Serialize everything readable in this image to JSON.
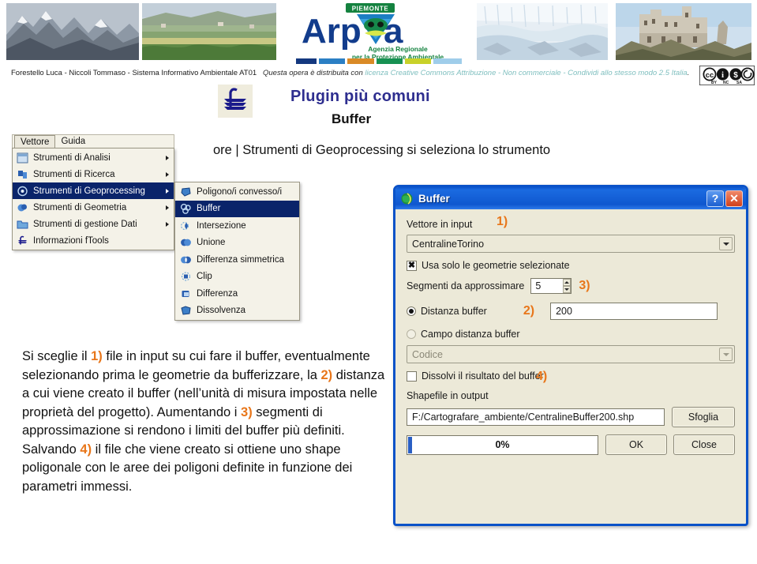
{
  "header": {
    "photos": [
      {
        "name": "snowy-mountains-photo",
        "alt": "Snowy mountain range"
      },
      {
        "name": "farmland-photo",
        "alt": "Cultivated farmland hills"
      },
      {
        "name": "glacier-waterfall-photo",
        "alt": "Glacier and waterfall"
      },
      {
        "name": "abbey-photo",
        "alt": "Sacra di San Michele abbey"
      }
    ],
    "logo": {
      "badge": "PIEMONTE",
      "wordmark": "Arpa",
      "line1": "Agenzia Regionale",
      "line2": "per la Protezione Ambientale"
    },
    "color_bar": [
      "#14387f",
      "#2b7fc4",
      "#d98a26",
      "#179152",
      "#c8d129",
      "#9fcdea"
    ]
  },
  "license": {
    "author": "Forestello Luca - Niccoli Tommaso - Sistema Informativo Ambientale AT01",
    "prefix": "Questa opera è distribuita con ",
    "link": "licenza Creative Commons Attribuzione - Non commerciale - Condividi allo stesso modo 2.5 Italia",
    "suffix": ".",
    "badge": "cc-by-nc-sa-badge"
  },
  "slide": {
    "title": "Plugin più comuni",
    "subtitle": "Buffer",
    "intro": "ore | Strumenti di Geoprocessing si seleziona lo strumento"
  },
  "menubar": {
    "items": [
      {
        "label": "Vettore",
        "active": true
      },
      {
        "label": "Guida",
        "active": false
      }
    ]
  },
  "menu": {
    "items": [
      {
        "label": "Strumenti di Analisi",
        "icon": "analysis-icon",
        "arrow": true,
        "selected": false
      },
      {
        "label": "Strumenti di Ricerca",
        "icon": "research-icon",
        "arrow": true,
        "selected": false
      },
      {
        "label": "Strumenti di Geoprocessing",
        "icon": "geoprocessing-icon",
        "arrow": true,
        "selected": true
      },
      {
        "label": "Strumenti di Geometria",
        "icon": "geometry-icon",
        "arrow": true,
        "selected": false
      },
      {
        "label": "Strumenti di gestione Dati",
        "icon": "data-management-icon",
        "arrow": true,
        "selected": false
      },
      {
        "label": "Informazioni fTools",
        "icon": "ftools-info-icon",
        "arrow": false,
        "selected": false
      }
    ]
  },
  "submenu": {
    "items": [
      {
        "label": "Poligono/i convesso/i",
        "icon": "convex-hull-icon",
        "selected": false
      },
      {
        "label": "Buffer",
        "icon": "buffer-icon",
        "selected": true
      },
      {
        "label": "Intersezione",
        "icon": "intersect-icon",
        "selected": false
      },
      {
        "label": "Unione",
        "icon": "union-icon",
        "selected": false
      },
      {
        "label": "Differenza simmetrica",
        "icon": "symmetric-difference-icon",
        "selected": false
      },
      {
        "label": "Clip",
        "icon": "clip-icon",
        "selected": false
      },
      {
        "label": "Differenza",
        "icon": "difference-icon",
        "selected": false
      },
      {
        "label": "Dissolvenza",
        "icon": "dissolve-icon",
        "selected": false
      }
    ]
  },
  "body_text": {
    "segments": [
      {
        "t": "Si sceglie il ",
        "n": false
      },
      {
        "t": "1)",
        "n": true
      },
      {
        "t": " file in input su cui fare il buffer, eventualmente selezionando prima le geometrie da bufferizzare, la ",
        "n": false
      },
      {
        "t": "2)",
        "n": true
      },
      {
        "t": " distanza a cui viene creato il buffer (nell’unità di misura impostata nelle proprietà del progetto). Aumentando i ",
        "n": false
      },
      {
        "t": "3)",
        "n": true
      },
      {
        "t": " segmenti di approssimazione si rendono i limiti del buffer più definiti.",
        "n": false
      },
      {
        "t": "BREAK",
        "n": false
      },
      {
        "t": "Salvando ",
        "n": false
      },
      {
        "t": "4)",
        "n": true
      },
      {
        "t": " il file che viene creato si ottiene uno shape poligonale con le aree dei poligoni definite in funzione dei parametri immessi.",
        "n": false
      }
    ]
  },
  "dialog": {
    "title": "Buffer",
    "icon": "qgis-globe-icon",
    "help_button": "?",
    "close_button": "✕",
    "input_vector_label": "Vettore in input",
    "input_vector_value": "CentralineTorino",
    "marker_1": "1)",
    "selected_only_label": "Usa solo le geometrie selezionate",
    "selected_only_checked": "✖",
    "segments_label": "Segmenti da approssimare",
    "segments_value": "5",
    "marker_3": "3)",
    "buffer_distance_label": "Distanza buffer",
    "buffer_distance_value": "200",
    "marker_2": "2)",
    "distance_field_label": "Campo distanza buffer",
    "distance_field_value": "Codice",
    "dissolve_label": "Dissolvi il risultato del buffer",
    "output_label": "Shapefile in output",
    "marker_4": "4)",
    "output_path": "F:/Cartografare_ambiente/CentralineBuffer200.shp",
    "browse_button": "Sfoglia",
    "progress_text": "0%",
    "ok_button": "OK",
    "close_label": "Close"
  },
  "colors": {
    "accent_orange": "#e8761a",
    "title_blue": "#2e2e8f",
    "menu_select": "#0a246a",
    "dialog_border": "#0a52c8",
    "dialog_face": "#ece9d8"
  }
}
